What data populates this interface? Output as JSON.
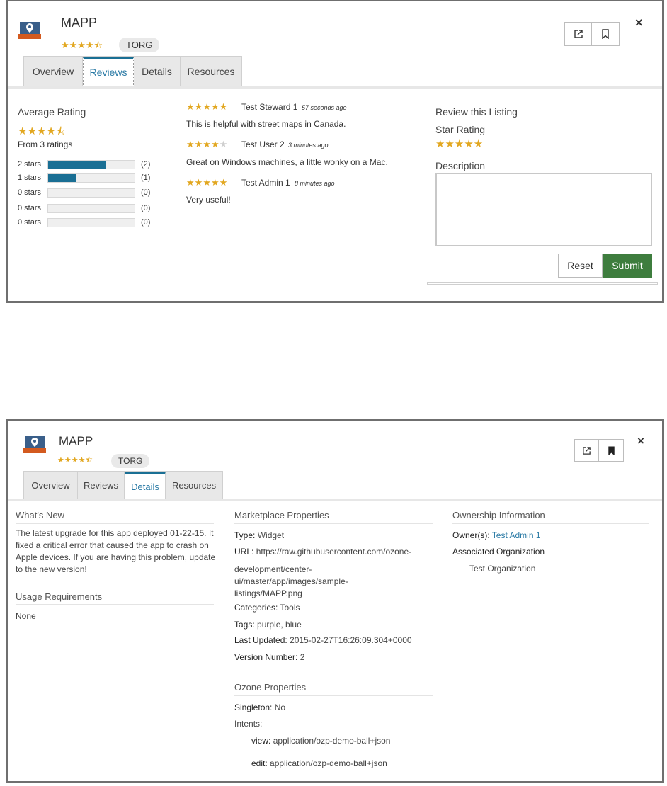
{
  "panels": [
    {
      "app": {
        "name": "MAPP",
        "rating_stars": "★★★★⯪",
        "badge": "TORG"
      },
      "actions": {
        "launch_icon": "external-link-icon",
        "bookmark_icon": "bookmark-icon",
        "close": "×"
      },
      "tabs": [
        "Overview",
        "Reviews",
        "Details",
        "Resources"
      ],
      "active_tab": "Reviews"
    },
    {
      "app": {
        "name": "MAPP",
        "rating_stars": "★★★★⯪",
        "badge": "TORG"
      },
      "actions": {
        "launch_icon": "external-link-icon",
        "bookmark_icon": "bookmark-filled-icon",
        "close": "×"
      },
      "tabs": [
        "Overview",
        "Reviews",
        "Details",
        "Resources"
      ],
      "active_tab": "Details"
    }
  ],
  "reviews": {
    "average": {
      "heading": "Average Rating",
      "stars": "★★★★⯪",
      "from": "From 3 ratings",
      "rows": [
        {
          "label": "2 stars",
          "count": "(2)",
          "fraction": 0.67
        },
        {
          "label": "1 stars",
          "count": "(1)",
          "fraction": 0.33
        },
        {
          "label": "0 stars",
          "count": "(0)",
          "fraction": 0
        },
        {
          "label": "0 stars",
          "count": "(0)",
          "fraction": 0
        },
        {
          "label": "0 stars",
          "count": "(0)",
          "fraction": 0
        }
      ]
    },
    "list": [
      {
        "stars": 5,
        "author": "Test Steward 1",
        "time": "57 seconds ago",
        "text": "This is helpful with street maps in Canada."
      },
      {
        "stars": 4,
        "author": "Test User 2",
        "time": "3 minutes ago",
        "text": "Great on Windows machines, a little wonky on a Mac."
      },
      {
        "stars": 5,
        "author": "Test Admin 1",
        "time": "8 minutes ago",
        "text": "Very useful!"
      }
    ],
    "form": {
      "heading": "Review this Listing",
      "star_label": "Star Rating",
      "stars": "★★★★★",
      "desc_label": "Description",
      "desc_value": "",
      "reset": "Reset",
      "submit": "Submit"
    }
  },
  "details": {
    "whats_new": {
      "heading": "What's New",
      "text": "The latest upgrade for this app deployed 01-22-15. It fixed a critical error that caused the app to crash on Apple devices. If you are having this problem, update to the new version!"
    },
    "usage": {
      "heading": "Usage Requirements",
      "text": "None"
    },
    "marketplace": {
      "heading": "Marketplace Properties",
      "type_label": "Type:",
      "type": "Widget",
      "url_label": "URL:",
      "url_line1": "https://raw.githubusercontent.com/ozone-",
      "url_line2": "development/center-",
      "url_line3": "ui/master/app/images/sample-",
      "url_line4": "listings/MAPP.png",
      "categories_label": "Categories:",
      "categories": "Tools",
      "tags_label": "Tags:",
      "tags": "purple, blue",
      "updated_label": "Last Updated:",
      "updated": "2015-02-27T16:26:09.304+0000",
      "version_label": "Version Number:",
      "version": "2"
    },
    "ozone": {
      "heading": "Ozone Properties",
      "singleton_label": "Singleton:",
      "singleton": "No",
      "intents_label": "Intents:",
      "intent1_label": "view:",
      "intent1": "application/ozp-demo-ball+json",
      "intent2_label": "edit:",
      "intent2": "application/ozp-demo-ball+json"
    },
    "ownership": {
      "heading": "Ownership Information",
      "owners_label": "Owner(s):",
      "owners": "Test Admin 1",
      "org_label": "Associated Organization",
      "org": "Test Organization"
    }
  }
}
